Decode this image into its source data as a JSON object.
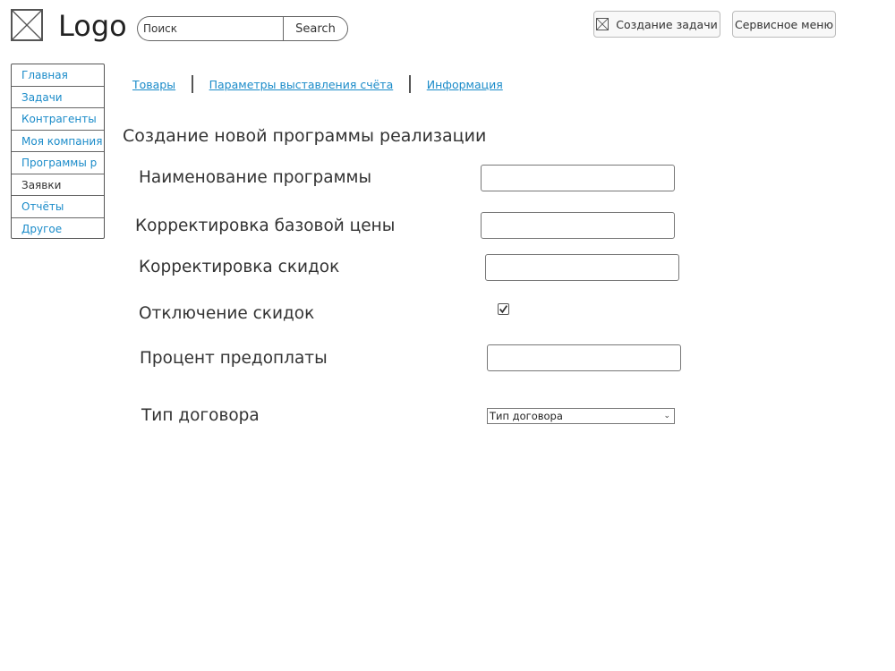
{
  "header": {
    "logo_text": "Logo",
    "search_placeholder": "Поиск",
    "search_button": "Search",
    "create_task": "Создание задачи",
    "service_menu": "Сервисное меню"
  },
  "sidebar": {
    "items": [
      {
        "label": "Главная"
      },
      {
        "label": "Задачи"
      },
      {
        "label": "Контрагенты"
      },
      {
        "label": "Моя компания"
      },
      {
        "label": "Программы р"
      },
      {
        "label": "Заявки"
      },
      {
        "label": "Отчёты"
      },
      {
        "label": "Другое"
      }
    ]
  },
  "tabs": [
    {
      "label": "Товары"
    },
    {
      "label": "Параметры выставления счёта"
    },
    {
      "label": "Информация"
    }
  ],
  "form": {
    "title": "Создание новой программы реализации",
    "program_name_label": "Наименование программы",
    "program_name_value": "",
    "base_price_label": "Корректировка базовой цены",
    "base_price_value": "",
    "discount_label": "Корректировка скидок",
    "discount_value": "",
    "disable_discounts_label": "Отключение скидок",
    "disable_discounts_checked": true,
    "prepayment_label": "Процент предоплаты",
    "prepayment_value": "",
    "contract_type_label": "Тип договора",
    "contract_type_selected": "Тип договора"
  },
  "colors": {
    "link": "#1a8bc9",
    "text": "#333333",
    "border": "#555555"
  }
}
